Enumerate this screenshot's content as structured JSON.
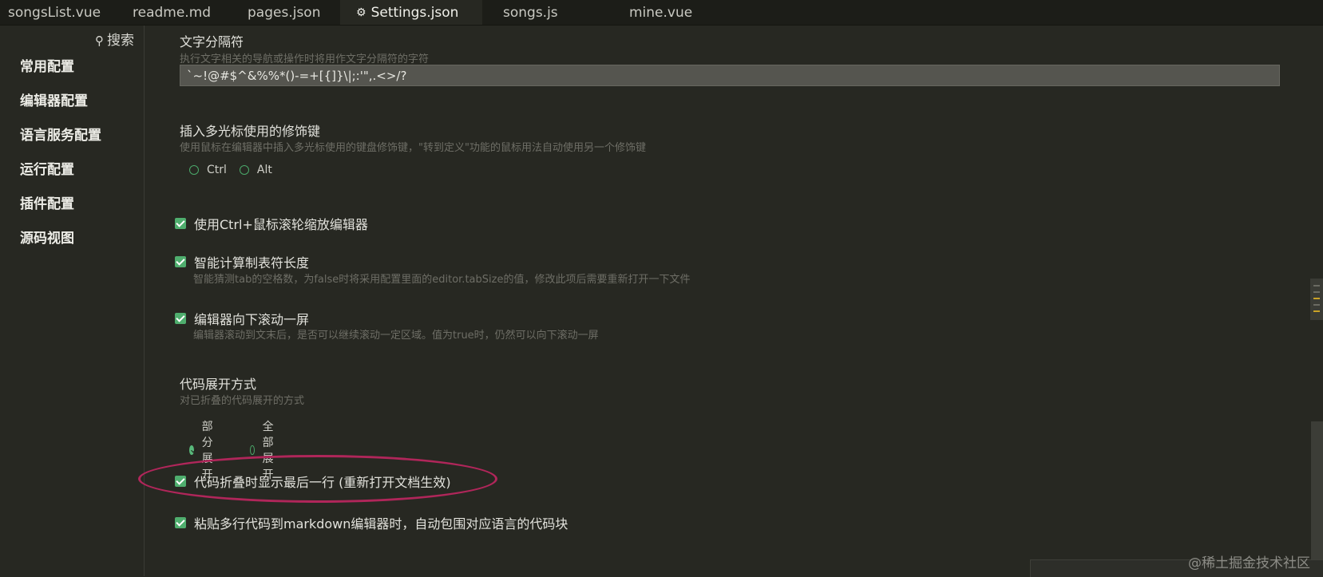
{
  "tabs": [
    {
      "label": "songsList.vue",
      "active": false
    },
    {
      "label": "readme.md",
      "active": false
    },
    {
      "label": "pages.json",
      "active": false
    },
    {
      "label": "Settings.json",
      "active": true
    },
    {
      "label": "songs.js",
      "active": false
    },
    {
      "label": "mine.vue",
      "active": false
    }
  ],
  "sidebar": {
    "search_label": "搜索",
    "items": [
      "常用配置",
      "编辑器配置",
      "语言服务配置",
      "运行配置",
      "插件配置",
      "源码视图"
    ]
  },
  "settings": {
    "word_separators": {
      "title": "文字分隔符",
      "description": "执行文字相关的导航或操作时将用作文字分隔符的字符",
      "value": "`~!@#$^&%%*()-=+[{]}\\|;:'\",.<>/?"
    },
    "multicursor_modifier": {
      "title": "插入多光标使用的修饰键",
      "description": "使用鼠标在编辑器中插入多光标使用的键盘修饰键，\"转到定义\"功能的鼠标用法自动使用另一个修饰键",
      "options": [
        "Ctrl",
        "Alt"
      ]
    },
    "ctrl_wheel_zoom": {
      "label": "使用Ctrl+鼠标滚轮缩放编辑器",
      "checked": true
    },
    "smart_tab_size": {
      "label": "智能计算制表符长度",
      "description": "智能猜测tab的空格数，为false时将采用配置里面的editor.tabSize的值，修改此项后需要重新打开一下文件",
      "checked": true
    },
    "scroll_beyond_last_line": {
      "label": "编辑器向下滚动一屏",
      "description": "编辑器滚动到文末后，是否可以继续滚动一定区域。值为true时，仍然可以向下滚动一屏",
      "checked": true
    },
    "code_unfold_mode": {
      "title": "代码展开方式",
      "description": "对已折叠的代码展开的方式",
      "options": [
        "部分展开",
        "全部展开"
      ],
      "selected": "部分展开"
    },
    "fold_show_last_line": {
      "label": "代码折叠时显示最后一行 (重新打开文档生效)",
      "checked": true
    },
    "markdown_paste_codeblock": {
      "label": "粘贴多行代码到markdown编辑器时，自动包围对应语言的代码块",
      "checked": true
    }
  },
  "icons": {
    "settings_tab": "gear-icon",
    "search": "search-icon"
  },
  "colors": {
    "accent_green": "#4fae6e",
    "highlight_ellipse": "#b0265a",
    "background": "#272822"
  },
  "watermark": "@稀土掘金技术社区"
}
